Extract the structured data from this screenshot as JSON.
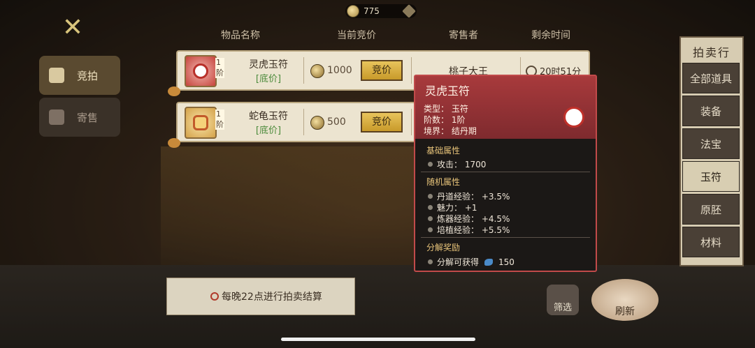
{
  "currency": {
    "amount": "775",
    "coin_icon": "coin-icon",
    "add_icon": "plus-icon"
  },
  "left_tabs": [
    {
      "label": "竞拍",
      "icon": "gavel-icon"
    },
    {
      "label": "寄售",
      "icon": "shop-icon"
    }
  ],
  "headers": {
    "name": "物品名称",
    "price": "当前竞价",
    "seller": "寄售者",
    "time": "剩余时间"
  },
  "rows": [
    {
      "tier": "1阶",
      "name": "灵虎玉符",
      "sub": "[底价]",
      "price": "1000",
      "bid": "竞价",
      "seller": "桃子大王",
      "time": "20时51分"
    },
    {
      "tier": "1阶",
      "name": "蛇龟玉符",
      "sub": "[底价]",
      "price": "500",
      "bid": "竞价",
      "seller": "",
      "time": ""
    }
  ],
  "categories": {
    "title": "拍卖行",
    "items": [
      "全部道具",
      "装备",
      "法宝",
      "玉符",
      "原胚",
      "材料"
    ],
    "selected_index": 3
  },
  "notice": "每晚22点进行拍卖结算",
  "filter_label": "筛选",
  "refresh_label": "刷新",
  "tooltip": {
    "title": "灵虎玉符",
    "type_line": "类型：  玉符",
    "tier_line": "阶数：  1阶",
    "realm_line": "境界：  结丹期",
    "base_title": "基础属性",
    "base_stats": [
      "攻击：  1700"
    ],
    "random_title": "随机属性",
    "random_stats": [
      "丹道经验：  +3.5%",
      "魅力：  +1",
      "炼器经验：  +4.5%",
      "培植经验：  +5.5%"
    ],
    "reward_title": "分解奖励",
    "reward_text": "分解可获得",
    "reward_value": "150"
  },
  "colors": {
    "accent_red": "#c14a4a",
    "gold": "#e8c45c",
    "green": "#4a8a3a"
  }
}
